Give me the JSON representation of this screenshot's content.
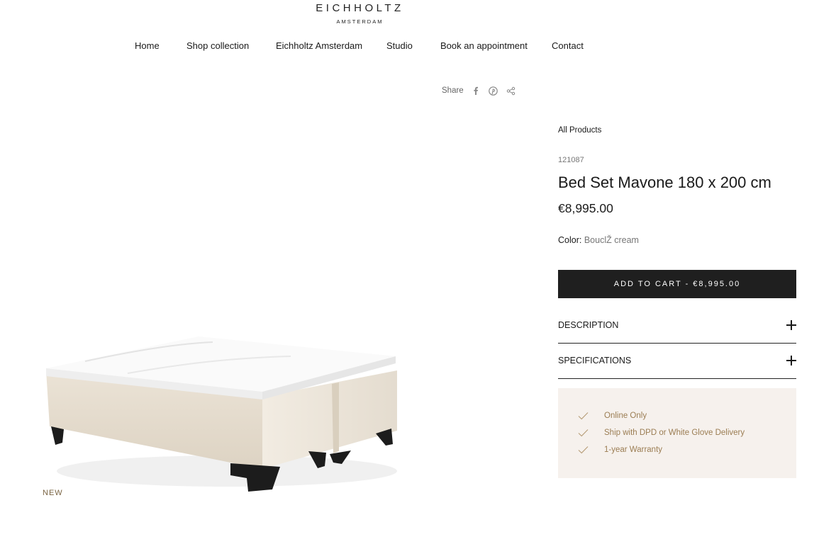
{
  "brand": {
    "name": "EICHHOLTZ",
    "sub": "AMSTERDAM"
  },
  "nav": {
    "items": [
      {
        "label": "Home"
      },
      {
        "label": "Shop collection"
      },
      {
        "label": "Eichholtz Amsterdam"
      },
      {
        "label": "Studio"
      },
      {
        "label": "Book an appointment"
      },
      {
        "label": "Contact"
      }
    ]
  },
  "share": {
    "label": "Share",
    "icons": [
      "facebook-icon",
      "pinterest-icon",
      "share-icon"
    ]
  },
  "product": {
    "breadcrumb": "All Products",
    "sku": "121087",
    "title": "Bed Set Mavone 180 x 200 cm",
    "price": "€8,995.00",
    "color_label": "Color:",
    "color_value": "BouclŽ cream",
    "badge": "NEW",
    "add_to_cart_label": "ADD TO CART - €8,995.00"
  },
  "accordion": {
    "description_label": "DESCRIPTION",
    "specifications_label": "SPECIFICATIONS"
  },
  "perks": {
    "items": [
      {
        "label": "Online Only"
      },
      {
        "label": "Ship with DPD or White Glove Delivery"
      },
      {
        "label": "1-year Warranty"
      }
    ],
    "icon": "check-icon"
  },
  "colors": {
    "button_bg": "#1f1f1f",
    "perks_bg": "#f6f1ed",
    "perks_text": "#9b7d53",
    "badge_text": "#7a6443"
  }
}
